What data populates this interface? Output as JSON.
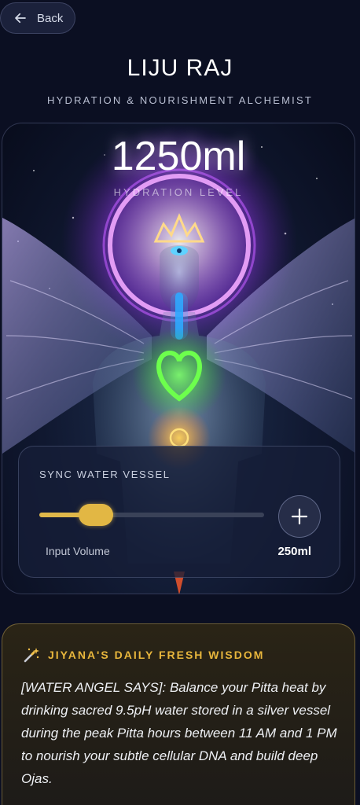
{
  "nav": {
    "back_label": "Back"
  },
  "profile": {
    "name": "LIJU RAJ",
    "subtitle": "HYDRATION & NOURISHMENT ALCHEMIST"
  },
  "hydration": {
    "value": "1250ml",
    "label": "HYDRATION LEVEL"
  },
  "sync": {
    "title": "SYNC WATER VESSEL",
    "input_label": "Input Volume",
    "input_value": "250ml",
    "slider_fraction": 0.25,
    "add_icon": "plus-icon"
  },
  "wisdom": {
    "icon": "magic-wand-icon",
    "title": "JIYANA'S DAILY FRESH WISDOM",
    "body": "[WATER ANGEL SAYS]: Balance your Pitta heat by drinking sacred 9.5pH water stored in a silver vessel during the peak Pitta hours between 11 AM and 1 PM to nourish your subtle cellular DNA and build deep Ojas."
  },
  "colors": {
    "background": "#0b0f22",
    "accent_gold": "#e2b744",
    "halo_purple": "#b24cff",
    "heart_green": "#39e639",
    "throat_blue": "#2fa8ff"
  }
}
